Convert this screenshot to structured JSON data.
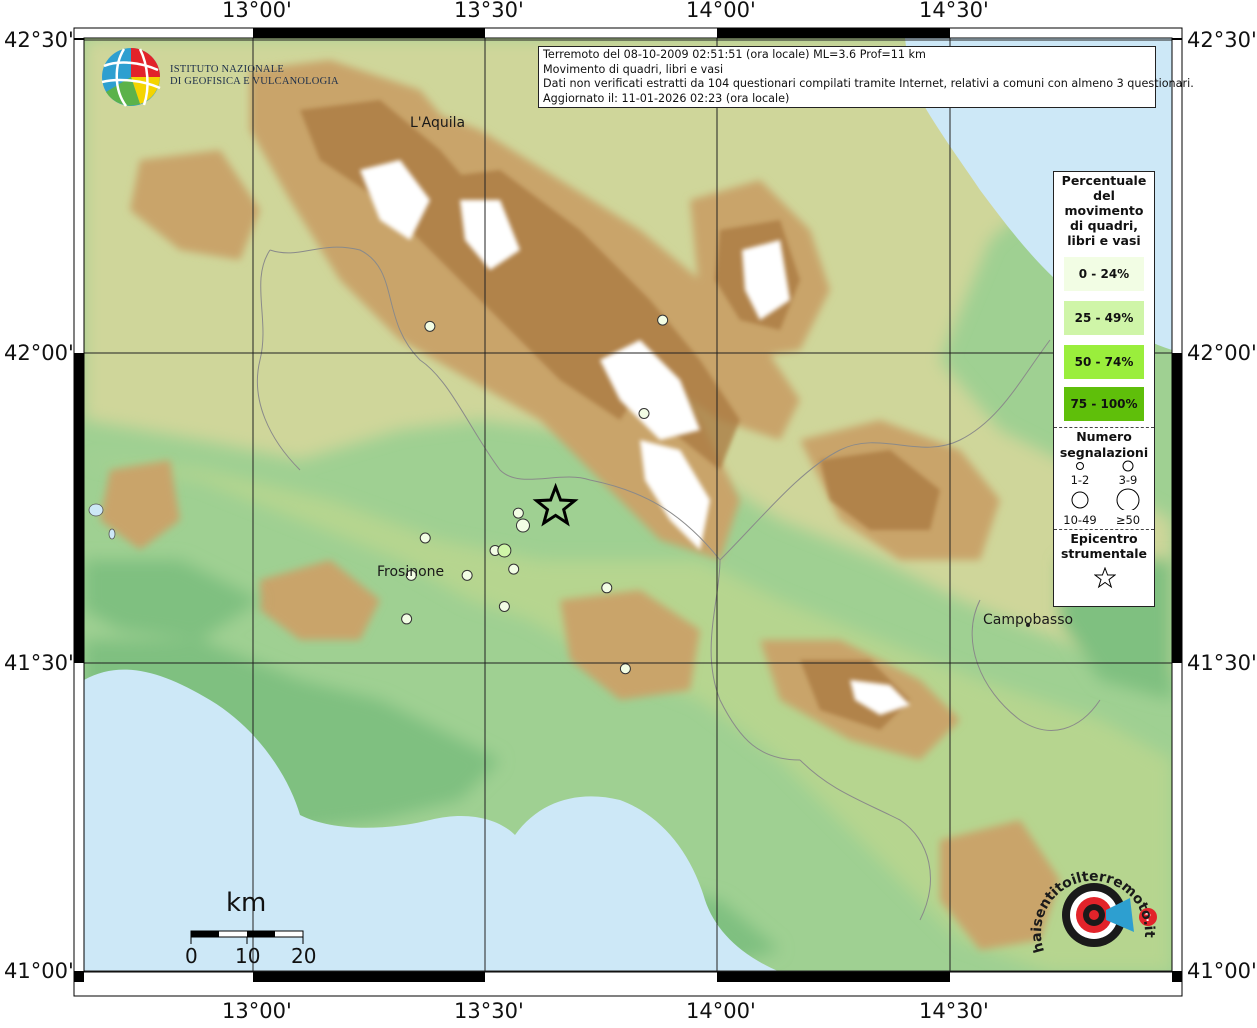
{
  "logo": {
    "line1": "ISTITUTO NAZIONALE",
    "line2": "DI GEOFISICA E VULCANOLOGIA",
    "icon": "ingv-globe-icon"
  },
  "info": {
    "line1": "Terremoto del 08-10-2009 02:51:51 (ora locale) ML=3.6 Prof=11 km",
    "line2": "Movimento di quadri, libri e vasi",
    "line3": "Dati non verificati estratti da 104 questionari compilati tramite Internet, relativi a comuni con almeno 3 questionari.",
    "line4": "Aggiornato il: 11-01-2026 02:23 (ora locale)"
  },
  "axes": {
    "lon_top": [
      "13°00'",
      "13°30'",
      "14°00'",
      "14°30'"
    ],
    "lon_bottom": [
      "13°00'",
      "13°30'",
      "14°00'",
      "14°30'"
    ],
    "lat_left": [
      "42°30'",
      "42°00'",
      "41°30'",
      "41°00'"
    ],
    "lat_right": [
      "42°30'",
      "42°00'",
      "41°30'",
      "41°00'"
    ]
  },
  "cities": {
    "laquila": "L'Aquila",
    "frosinone": "Frosinone",
    "campobasso": "Campobasso"
  },
  "legend": {
    "title_lines": [
      "Percentuale",
      "del",
      "movimento",
      "di quadri,",
      "libri e vasi"
    ],
    "classes": [
      {
        "label": "0 - 24%",
        "color": "#f2fde4"
      },
      {
        "label": "25 - 49%",
        "color": "#cff5a8"
      },
      {
        "label": "50 - 74%",
        "color": "#9aee3c"
      },
      {
        "label": "75 - 100%",
        "color": "#5fbf0a"
      }
    ],
    "count_title_1": "Numero",
    "count_title_2": "segnalazioni",
    "count_labels": [
      "1-2",
      "3-9",
      "10-49",
      "≥50"
    ],
    "epi_title_1": "Epicentro",
    "epi_title_2": "strumentale",
    "epi_icon": "star-icon"
  },
  "scale": {
    "unit": "km",
    "labels": [
      "0",
      "10",
      "20"
    ]
  },
  "badge": {
    "text": "haisentitoilterremoto.it",
    "icon": "target-megaphone-icon"
  },
  "colors": {
    "sea": "#cfe8f7",
    "lowland": "#7fc47f",
    "hill": "#d8c98a",
    "mountain": "#b98a4f",
    "peak": "#ffffff",
    "obs_0_24": "#f2fde4",
    "obs_25_49": "#cff5a8"
  },
  "observations": [
    {
      "lon": 13.38,
      "lat": 42.04,
      "class": "0 - 24%",
      "reports": "1-2"
    },
    {
      "lon": 13.88,
      "lat": 42.05,
      "class": "0 - 24%",
      "reports": "1-2"
    },
    {
      "lon": 13.84,
      "lat": 41.9,
      "class": "0 - 24%",
      "reports": "1-2"
    },
    {
      "lon": 13.57,
      "lat": 41.74,
      "class": "0 - 24%",
      "reports": "1-2"
    },
    {
      "lon": 13.58,
      "lat": 41.72,
      "class": "0 - 24%",
      "reports": "3-9"
    },
    {
      "lon": 13.37,
      "lat": 41.7,
      "class": "0 - 24%",
      "reports": "1-2"
    },
    {
      "lon": 13.52,
      "lat": 41.68,
      "class": "0 - 24%",
      "reports": "1-2"
    },
    {
      "lon": 13.54,
      "lat": 41.68,
      "class": "25 - 49%",
      "reports": "3-9"
    },
    {
      "lon": 13.56,
      "lat": 41.65,
      "class": "0 - 24%",
      "reports": "1-2"
    },
    {
      "lon": 13.46,
      "lat": 41.64,
      "class": "0 - 24%",
      "reports": "1-2"
    },
    {
      "lon": 13.34,
      "lat": 41.64,
      "class": "0 - 24%",
      "reports": "1-2"
    },
    {
      "lon": 13.76,
      "lat": 41.62,
      "class": "0 - 24%",
      "reports": "1-2"
    },
    {
      "lon": 13.54,
      "lat": 41.59,
      "class": "0 - 24%",
      "reports": "1-2"
    },
    {
      "lon": 13.33,
      "lat": 41.57,
      "class": "0 - 24%",
      "reports": "1-2"
    },
    {
      "lon": 13.8,
      "lat": 41.49,
      "class": "0 - 24%",
      "reports": "1-2"
    }
  ],
  "epicenter": {
    "lon": 13.65,
    "lat": 41.75
  }
}
